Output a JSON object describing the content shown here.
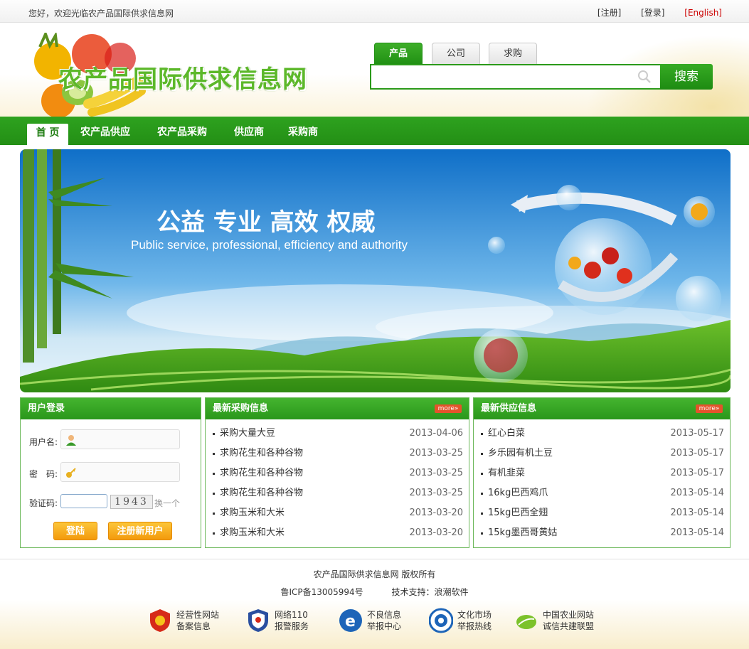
{
  "topbar": {
    "welcome": "您好，欢迎光临农产品国际供求信息网",
    "register": "[注册]",
    "login": "[登录]",
    "english": "[English]"
  },
  "header": {
    "logo_text": "农产品国际供求信息网",
    "tabs": [
      {
        "label": "产品",
        "active": true
      },
      {
        "label": "公司",
        "active": false
      },
      {
        "label": "求购",
        "active": false
      }
    ],
    "search_button": "搜索",
    "search_placeholder": ""
  },
  "nav": {
    "items": [
      {
        "label": "首 页",
        "active": true
      },
      {
        "label": "农产品供应",
        "active": false
      },
      {
        "label": "农产品采购",
        "active": false
      },
      {
        "label": "供应商",
        "active": false
      },
      {
        "label": "采购商",
        "active": false
      }
    ]
  },
  "banner": {
    "headline": "公益  专业  高效  权威",
    "subline": "Public service, professional, efficiency and authority"
  },
  "login_box": {
    "title": "用户登录",
    "username_label": "用户名:",
    "password_label": "密　码:",
    "captcha_label": "验证码:",
    "captcha_text": "1943",
    "captcha_refresh": "换一个",
    "login_button": "登陆",
    "register_button": "注册新用户"
  },
  "purchase_box": {
    "title": "最新采购信息",
    "more": "more»",
    "items": [
      {
        "title": "采购大量大豆",
        "date": "2013-04-06"
      },
      {
        "title": "求购花生和各种谷物",
        "date": "2013-03-25"
      },
      {
        "title": "求购花生和各种谷物",
        "date": "2013-03-25"
      },
      {
        "title": "求购花生和各种谷物",
        "date": "2013-03-25"
      },
      {
        "title": "求购玉米和大米",
        "date": "2013-03-20"
      },
      {
        "title": "求购玉米和大米",
        "date": "2013-03-20"
      }
    ]
  },
  "supply_box": {
    "title": "最新供应信息",
    "more": "more»",
    "items": [
      {
        "title": "红心白菜",
        "date": "2013-05-17"
      },
      {
        "title": "乡乐园有机土豆",
        "date": "2013-05-17"
      },
      {
        "title": "有机韭菜",
        "date": "2013-05-17"
      },
      {
        "title": "16kg巴西鸡爪",
        "date": "2013-05-14"
      },
      {
        "title": "15kg巴西全翅",
        "date": "2013-05-14"
      },
      {
        "title": "15kg墨西哥黄姑",
        "date": "2013-05-14"
      }
    ]
  },
  "footer": {
    "copyright": "农产品国际供求信息网 版权所有",
    "icp": "鲁ICP备13005994号",
    "tech_support": "技术支持：浪潮软件",
    "badges": [
      {
        "line1": "经营性网站",
        "line2": "备案信息",
        "icon": "red-shield-icon"
      },
      {
        "line1": "网络110",
        "line2": "报警服务",
        "icon": "police-badge-icon"
      },
      {
        "line1": "不良信息",
        "line2": "举报中心",
        "icon": "report-e-icon"
      },
      {
        "line1": "文化市场",
        "line2": "举报热线",
        "icon": "culture-market-icon"
      },
      {
        "line1": "中国农业网站",
        "line2": "诚信共建联盟",
        "icon": "agri-leaf-icon"
      }
    ]
  },
  "colors": {
    "brand_green": "#2ea21f",
    "accent_orange": "#f39a0c",
    "english_red": "#cc0000"
  }
}
